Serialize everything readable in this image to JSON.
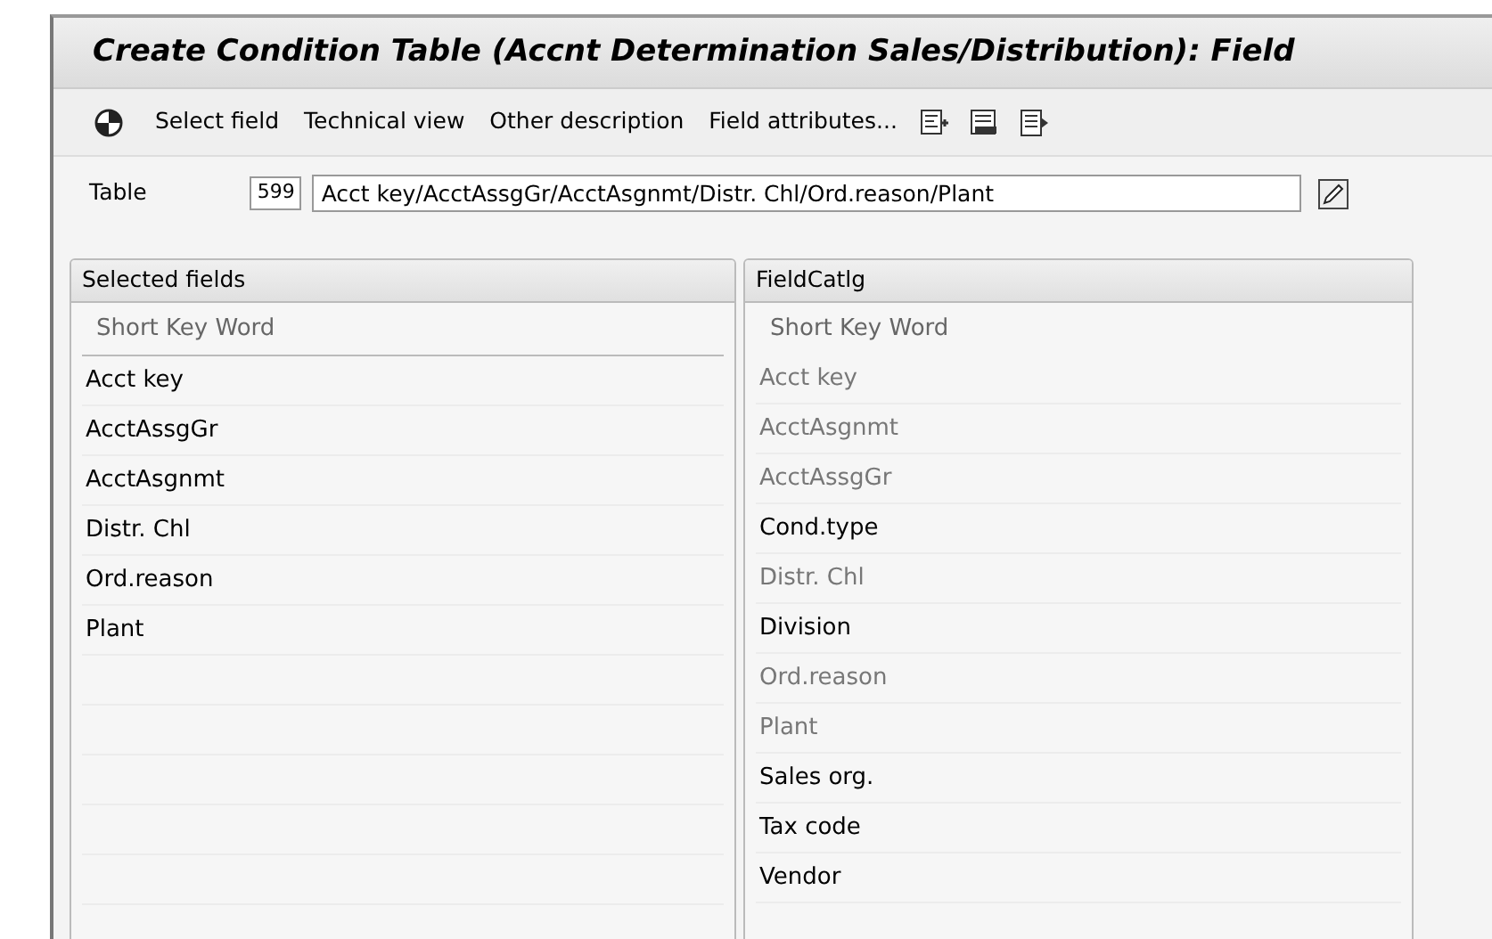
{
  "window": {
    "title": "Create Condition Table (Accnt Determination Sales/Distribution): Field"
  },
  "toolbar": {
    "buttons": [
      {
        "kind": "icon"
      },
      {
        "kind": "text",
        "label": "Select field"
      },
      {
        "kind": "text",
        "label": "Technical view"
      },
      {
        "kind": "text",
        "label": "Other description"
      },
      {
        "kind": "text",
        "label": "Field attributes..."
      },
      {
        "kind": "icon"
      },
      {
        "kind": "icon"
      },
      {
        "kind": "icon"
      }
    ]
  },
  "table": {
    "label": "Table",
    "number": "599",
    "description": "Acct key/AcctAssgGr/AcctAsgnmt/Distr. Chl/Ord.reason/Plant"
  },
  "selected_fields": {
    "title": "Selected fields",
    "column": "Short Key Word",
    "rows": [
      "Acct key",
      "AcctAssgGr",
      "AcctAsgnmt",
      "Distr. Chl",
      "Ord.reason",
      "Plant"
    ]
  },
  "field_catalog": {
    "title": "FieldCatlg",
    "column": "Short Key Word",
    "rows": [
      {
        "label": "Acct key",
        "disabled": true
      },
      {
        "label": "AcctAsgnmt",
        "disabled": true
      },
      {
        "label": "AcctAssgGr",
        "disabled": true
      },
      {
        "label": "Cond.type",
        "disabled": false
      },
      {
        "label": "Distr. Chl",
        "disabled": true
      },
      {
        "label": "Division",
        "disabled": false
      },
      {
        "label": "Ord.reason",
        "disabled": true
      },
      {
        "label": "Plant",
        "disabled": true
      },
      {
        "label": "Sales org.",
        "disabled": false
      },
      {
        "label": "Tax code",
        "disabled": false
      },
      {
        "label": "Vendor",
        "disabled": false
      }
    ]
  }
}
